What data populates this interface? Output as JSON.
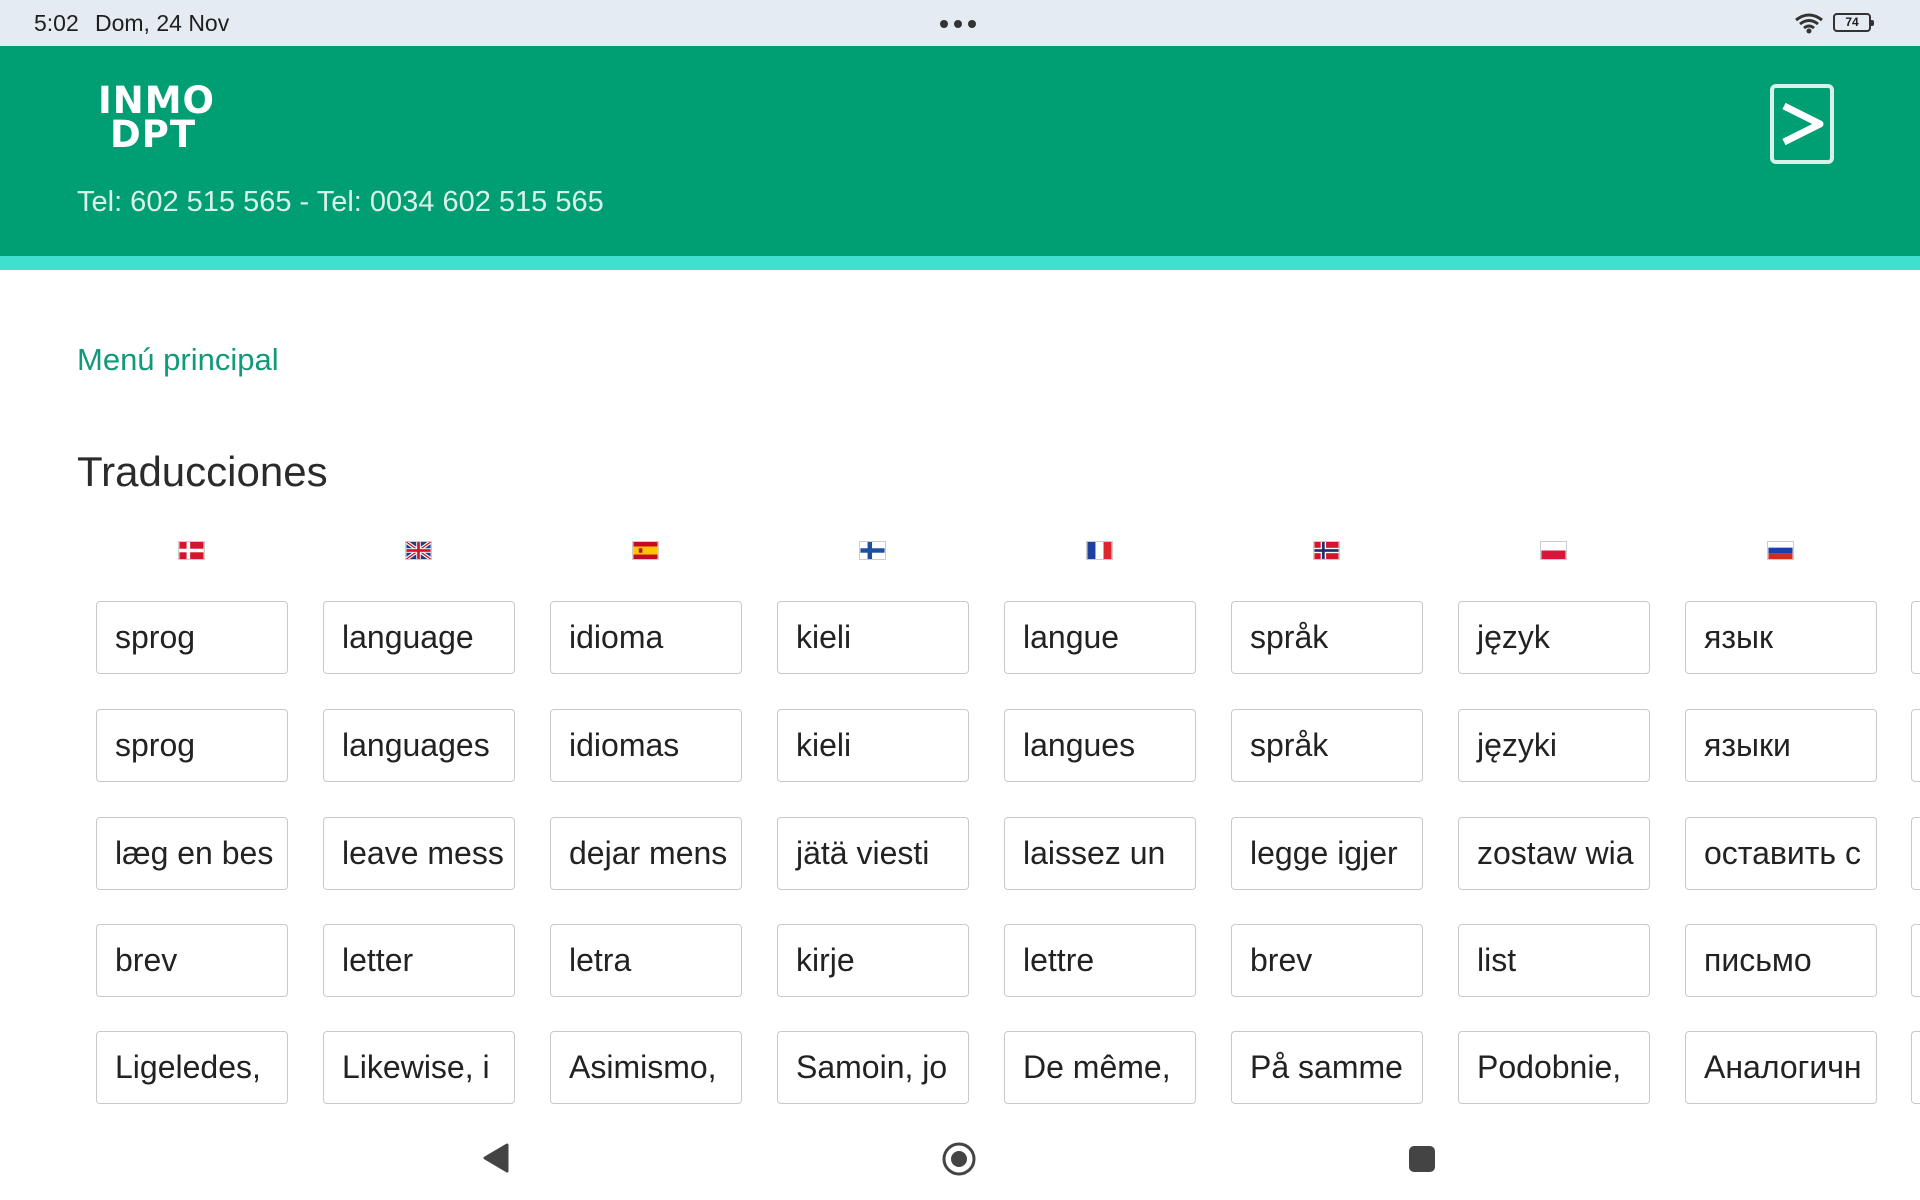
{
  "status_bar": {
    "time": "5:02",
    "date": "Dom, 24 Nov",
    "battery": "74"
  },
  "header": {
    "logo_line1": "INMO",
    "logo_line2": "DPT",
    "phone": "Tel: 602 515 565 - Tel: 0034 602 515 565",
    "login_icon": "login-arrow-icon"
  },
  "main": {
    "menu_link": "Menú principal",
    "title": "Traducciones"
  },
  "flags": [
    {
      "name": "denmark-flag-icon"
    },
    {
      "name": "uk-flag-icon"
    },
    {
      "name": "spain-flag-icon"
    },
    {
      "name": "finland-flag-icon"
    },
    {
      "name": "france-flag-icon"
    },
    {
      "name": "norway-flag-icon"
    },
    {
      "name": "poland-flag-icon"
    },
    {
      "name": "russia-flag-icon"
    }
  ],
  "rows": [
    [
      "sprog",
      "language",
      "idioma",
      "kieli",
      "langue",
      "språk",
      "język",
      "язык"
    ],
    [
      "sprog",
      "languages",
      "idiomas",
      "kieli",
      "langues",
      "språk",
      "języki",
      "языки"
    ],
    [
      "læg en bes",
      "leave mess",
      "dejar mens",
      "jätä viesti",
      "laissez un",
      "legge igjer",
      "zostaw wia",
      "оставить с"
    ],
    [
      "brev",
      "letter",
      "letra",
      "kirje",
      "lettre",
      "brev",
      "list",
      "письмо"
    ],
    [
      "Ligeledes,",
      "Likewise, i",
      "Asimismo,",
      "Samoin, jo",
      "De même,",
      "På samme",
      "Podobnie,",
      "Аналогичн"
    ]
  ],
  "colors": {
    "header": "#009e73",
    "stripe": "#40e0cf",
    "link": "#12997a"
  }
}
